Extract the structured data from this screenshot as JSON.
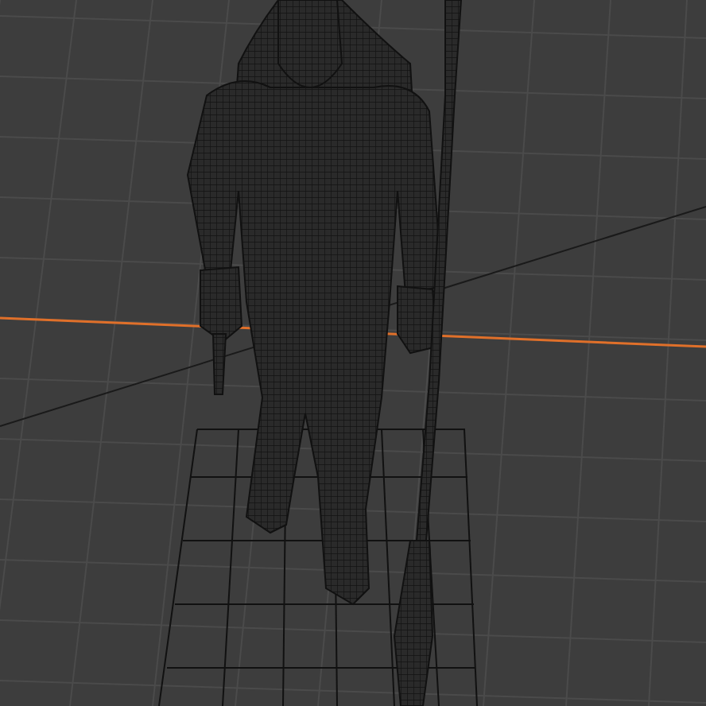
{
  "viewport": {
    "show_grid": true
  }
}
